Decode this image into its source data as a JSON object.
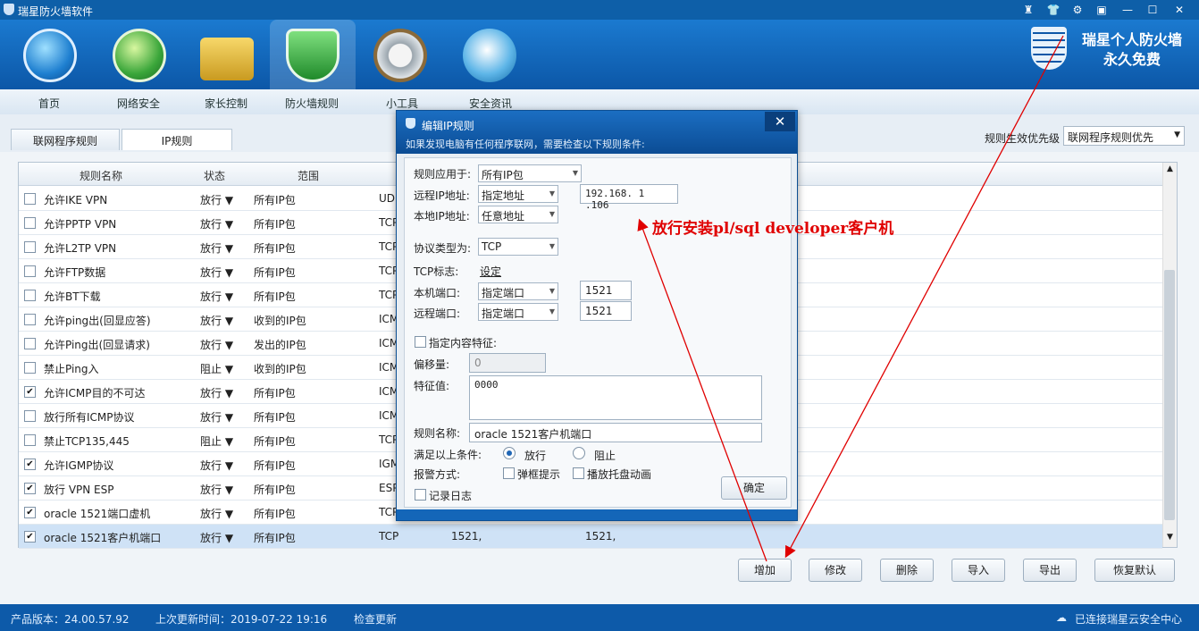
{
  "app": {
    "title": "瑞星防火墙软件"
  },
  "window_buttons": [
    "restore-user-icon",
    "shirt-icon",
    "gear-icon",
    "menu-icon",
    "minimize-icon",
    "maximize-icon",
    "close-icon"
  ],
  "brand": {
    "line1": "瑞星个人防火墙",
    "line2": "永久免费"
  },
  "nav": {
    "items": [
      {
        "label": "首页",
        "icon": "home-icon"
      },
      {
        "label": "网络安全",
        "icon": "network-globe-icon"
      },
      {
        "label": "家长控制",
        "icon": "lock-icon"
      },
      {
        "label": "防火墙规则",
        "icon": "shield-icon"
      },
      {
        "label": "小工具",
        "icon": "toolbox-gear-icon"
      },
      {
        "label": "安全资讯",
        "icon": "planet-icon"
      }
    ],
    "selected": "防火墙规则"
  },
  "subtabs": {
    "items": [
      "联网程序规则",
      "IP规则"
    ],
    "selected": "IP规则"
  },
  "priority": {
    "label": "规则生效优先级",
    "value": "联网程序规则优先"
  },
  "table": {
    "headers": {
      "name": "规则名称",
      "action": "状态",
      "range": "范围"
    },
    "rows": [
      {
        "checked": false,
        "name": "允许IKE VPN",
        "action": "放行 ▼",
        "range": "所有IP包",
        "proto": "UD",
        "lport": "",
        "rport": ""
      },
      {
        "checked": false,
        "name": "允许PPTP VPN",
        "action": "放行 ▼",
        "range": "所有IP包",
        "proto": "TCP",
        "lport": "",
        "rport": ""
      },
      {
        "checked": false,
        "name": "允许L2TP VPN",
        "action": "放行 ▼",
        "range": "所有IP包",
        "proto": "TCP",
        "lport": "",
        "rport": ""
      },
      {
        "checked": false,
        "name": "允许FTP数据",
        "action": "放行 ▼",
        "range": "所有IP包",
        "proto": "TCP",
        "lport": "",
        "rport": ""
      },
      {
        "checked": false,
        "name": "允许BT下载",
        "action": "放行 ▼",
        "range": "所有IP包",
        "proto": "TCP",
        "lport": "",
        "rport": ""
      },
      {
        "checked": false,
        "name": "允许ping出(回显应答)",
        "action": "放行 ▼",
        "range": "收到的IP包",
        "proto": "ICM",
        "lport": "",
        "rport": ""
      },
      {
        "checked": false,
        "name": "允许Ping出(回显请求)",
        "action": "放行 ▼",
        "range": "发出的IP包",
        "proto": "ICM",
        "lport": "",
        "rport": ""
      },
      {
        "checked": false,
        "name": "禁止Ping入",
        "action": "阻止 ▼",
        "range": "收到的IP包",
        "proto": "ICM",
        "lport": "",
        "rport": ""
      },
      {
        "checked": true,
        "name": "允许ICMP目的不可达",
        "action": "放行 ▼",
        "range": "所有IP包",
        "proto": "ICM",
        "lport": "",
        "rport": ""
      },
      {
        "checked": false,
        "name": "放行所有ICMP协议",
        "action": "放行 ▼",
        "range": "所有IP包",
        "proto": "ICM",
        "lport": "",
        "rport": ""
      },
      {
        "checked": false,
        "name": "禁止TCP135,445",
        "action": "阻止 ▼",
        "range": "所有IP包",
        "proto": "TCP",
        "lport": "",
        "rport": ""
      },
      {
        "checked": true,
        "name": "允许IGMP协议",
        "action": "放行 ▼",
        "range": "所有IP包",
        "proto": "IGM",
        "lport": "",
        "rport": ""
      },
      {
        "checked": true,
        "name": "放行 VPN ESP",
        "action": "放行 ▼",
        "range": "所有IP包",
        "proto": "ESP",
        "lport": "",
        "rport": ""
      },
      {
        "checked": true,
        "name": "oracle 1521端口虚机",
        "action": "放行 ▼",
        "range": "所有IP包",
        "proto": "TCP",
        "lport": "",
        "rport": ""
      },
      {
        "checked": true,
        "name": "oracle 1521客户机端口",
        "action": "放行 ▼",
        "range": "所有IP包",
        "proto": "TCP",
        "lport": "1521,",
        "rport": "1521,",
        "selected": true
      }
    ]
  },
  "buttons": {
    "add": "增加",
    "edit": "修改",
    "delete": "删除",
    "import": "导入",
    "export": "导出",
    "reset": "恢复默认"
  },
  "status": {
    "version": "产品版本：24.00.57.92",
    "last_update": "上次更新时间：2019-07-22 19:16",
    "check": "检查更新",
    "cloud": "已连接瑞星云安全中心"
  },
  "dialog": {
    "title": "编辑IP规则",
    "subtitle": "如果发现电脑有任何程序联网，需要检查以下规则条件:",
    "apply_label": "规则应用于:",
    "apply_value": "所有IP包",
    "remote_ip_label": "远程IP地址:",
    "remote_ip_mode": "指定地址",
    "remote_ip_value": "192.168. 1 .106",
    "local_ip_label": "本地IP地址:",
    "local_ip_mode": "任意地址",
    "protocol_label": "协议类型为:",
    "protocol_value": "TCP",
    "tcp_flag_label": "TCP标志:",
    "tcp_flag_link": "设定",
    "local_port_label": "本机端口:",
    "local_port_mode": "指定端口",
    "local_port_value": "1521",
    "remote_port_label": "远程端口:",
    "remote_port_mode": "指定端口",
    "remote_port_value": "1521",
    "content_label": "指定内容特征:",
    "offset_label": "偏移量:",
    "offset_value": "0",
    "feature_label": "特征值:",
    "feature_value": "0000",
    "rule_name_label": "规则名称:",
    "rule_name_value": "oracle 1521客户机端口",
    "condition_label": "满足以上条件:",
    "allow": "放行",
    "block": "阻止",
    "alert_label": "报警方式:",
    "popup": "弹框提示",
    "tray": "播放托盘动画",
    "log": "记录日志",
    "ok": "确定"
  },
  "annotation": "放行安装pl/sql developer客户机",
  "colors": {
    "accent": "#0d5aa9",
    "annotation": "#e00000"
  }
}
